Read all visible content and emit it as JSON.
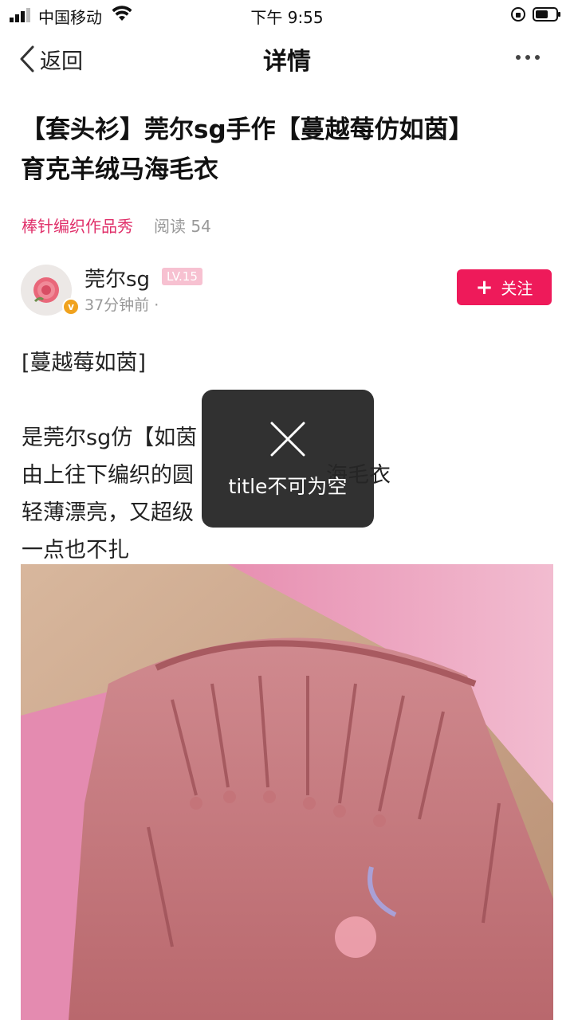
{
  "status_bar": {
    "carrier": "中国移动",
    "time": "下午 9:55"
  },
  "nav": {
    "back_label": "返回",
    "title": "详情"
  },
  "article": {
    "title_lines": [
      "【套头衫】莞尔sg手作【蔓越莓仿如茵】",
      "育克羊绒马海毛衣"
    ],
    "category": "棒针编织作品秀",
    "reads": "阅读 54"
  },
  "author": {
    "name": "莞尔sg",
    "level": "LV.15",
    "time": "37分钟前 ·",
    "verified_mark": "v",
    "follow_label": "关注",
    "follow_plus": "+"
  },
  "body": {
    "lines": [
      "[蔓越莓如茵]",
      "",
      "是莞尔sg仿【如茵",
      "由上往下编织的圆",
      "轻薄漂亮，又超级",
      "一点也不扎"
    ],
    "hidden_suffix_line4": "海毛衣"
  },
  "toast": {
    "message": "title不可为空",
    "icon": "close-icon"
  },
  "colors": {
    "accent": "#ee1a5a",
    "category": "#e0306a",
    "level_badge": "#f7c1d1",
    "verified": "#f0a21e"
  }
}
